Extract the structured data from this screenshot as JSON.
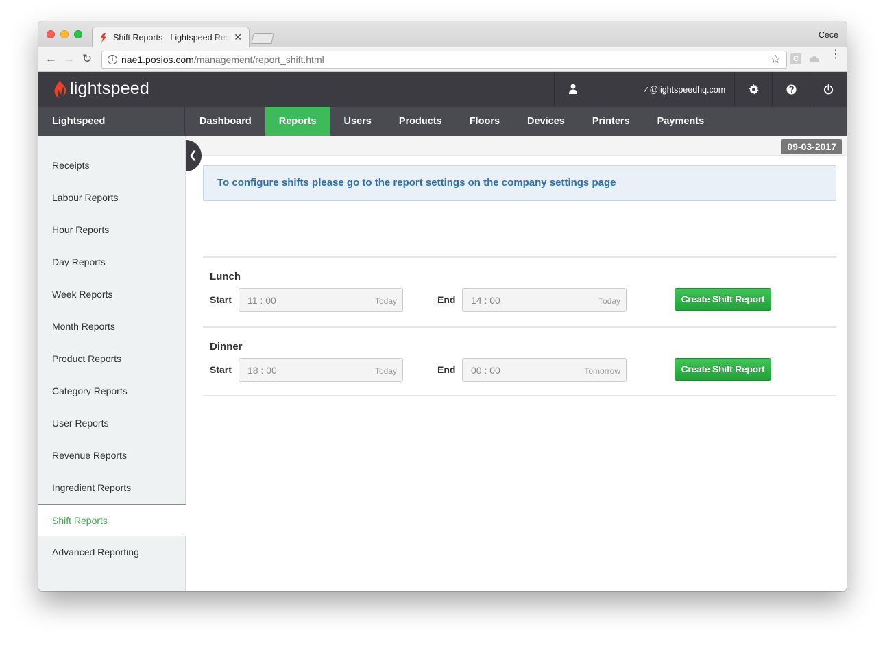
{
  "browser": {
    "tab_title": "Shift Reports - Lightspeed Restaurant",
    "tab_close": "✕",
    "profile_name": "Cece",
    "url_host": "nae1.posios.com",
    "url_path": "/management/report_shift.html",
    "ext_c_label": "C"
  },
  "app": {
    "logo_text": "lightspeed",
    "user_email": "✓@lightspeedhq.com",
    "brand_label": "Lightspeed",
    "nav": [
      {
        "label": "Dashboard"
      },
      {
        "label": "Reports"
      },
      {
        "label": "Users"
      },
      {
        "label": "Products"
      },
      {
        "label": "Floors"
      },
      {
        "label": "Devices"
      },
      {
        "label": "Printers"
      },
      {
        "label": "Payments"
      }
    ],
    "active_nav": "Reports",
    "accent_color": "#3dba5a",
    "header_color": "#3b3b41"
  },
  "sidebar": {
    "items": [
      {
        "label": "Receipts"
      },
      {
        "label": "Labour Reports"
      },
      {
        "label": "Hour Reports"
      },
      {
        "label": "Day Reports"
      },
      {
        "label": "Week Reports"
      },
      {
        "label": "Month Reports"
      },
      {
        "label": "Product Reports"
      },
      {
        "label": "Category Reports"
      },
      {
        "label": "User Reports"
      },
      {
        "label": "Revenue Reports"
      },
      {
        "label": "Ingredient Reports"
      },
      {
        "label": "Shift Reports"
      },
      {
        "label": "Advanced Reporting"
      }
    ],
    "active_item": "Shift Reports"
  },
  "main": {
    "date": "09-03-2017",
    "info_message": "To configure shifts please go to the report settings on the company settings page",
    "start_label": "Start",
    "end_label": "End",
    "shifts": [
      {
        "name": "Lunch",
        "start_time": "11 : 00",
        "start_day": "Today",
        "end_time": "14 : 00",
        "end_day": "Today",
        "button_label": "Create Shift Report"
      },
      {
        "name": "Dinner",
        "start_time": "18 : 00",
        "start_day": "Today",
        "end_time": "00 : 00",
        "end_day": "Tomorrow",
        "button_label": "Create Shift Report"
      }
    ]
  }
}
